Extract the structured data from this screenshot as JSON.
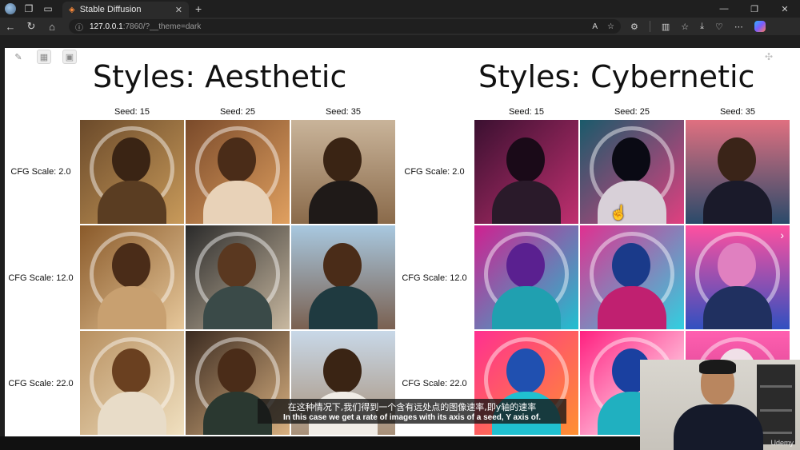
{
  "browser": {
    "tab_title": "Stable Diffusion",
    "url_host": "127.0.0.1",
    "url_path": ":7860/?__theme=dark"
  },
  "sections": [
    {
      "title": "Styles: Aesthetic",
      "seeds": [
        "Seed: 15",
        "Seed: 25",
        "Seed: 35"
      ],
      "cfg": [
        "CFG Scale: 2.0",
        "CFG Scale: 12.0",
        "CFG Scale: 22.0"
      ]
    },
    {
      "title": "Styles: Cybernetic",
      "seeds": [
        "Seed: 15",
        "Seed: 25",
        "Seed: 35"
      ],
      "cfg": [
        "CFG Scale: 2.0",
        "CFG Scale: 12.0",
        "CFG Scale: 22.0"
      ]
    }
  ],
  "subtitles": {
    "zh": "在这种情况下,我们得到一个含有远处点的图像速率,即y轴的速率",
    "en": "In this case we get a rate of images with its axis of a seed, Y axis of."
  },
  "watermark": "Udemy",
  "colors": {
    "aesthetic_bg": "#a87a4a",
    "cyber_bg": "#c2287a"
  }
}
